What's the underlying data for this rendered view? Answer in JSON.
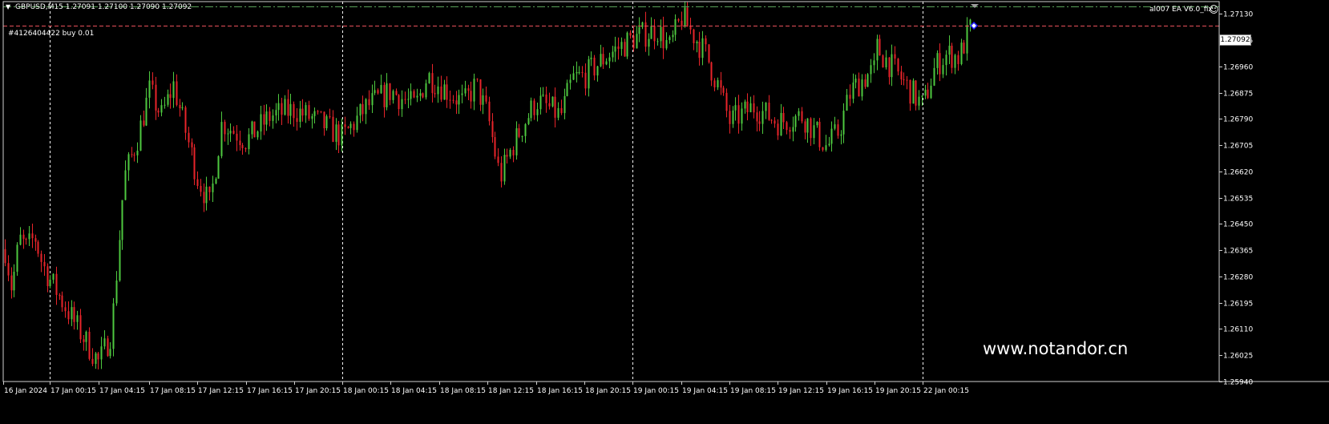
{
  "header": {
    "symbol_info": "GBPUSD,M15  1.27091 1.27100 1.27090 1.27092",
    "ea_label": "al007 EA  V6.0_fix",
    "order_label": "#4126404422 buy 0.01"
  },
  "icons": {
    "collapse": "triangle-down-icon",
    "ea_status": "smiley-icon",
    "order_marker": "diamond-icon"
  },
  "watermark": "www.notandor.cn",
  "current_price_tag": "1.27092",
  "colors": {
    "background": "#000000",
    "bull": "#4ec83f",
    "bear": "#e8242a",
    "grid": "#ffffff",
    "order_line": "#e8505a",
    "top_line": "#5aa05a"
  },
  "chart_data": {
    "type": "candlestick",
    "title": "GBPUSD,M15",
    "ylim": [
      1.2594,
      1.2717
    ],
    "price_ticks": [
      "1.27130",
      "1.27045",
      "1.26960",
      "1.26875",
      "1.26790",
      "1.26705",
      "1.26620",
      "1.26535",
      "1.26450",
      "1.26365",
      "1.26280",
      "1.26195",
      "1.26110",
      "1.26025",
      "1.25940"
    ],
    "time_ticks": [
      "16 Jan 2024",
      "17 Jan 00:15",
      "17 Jan 04:15",
      "17 Jan 08:15",
      "17 Jan 12:15",
      "17 Jan 16:15",
      "17 Jan 20:15",
      "18 Jan 00:15",
      "18 Jan 04:15",
      "18 Jan 08:15",
      "18 Jan 12:15",
      "18 Jan 16:15",
      "18 Jan 20:15",
      "19 Jan 00:15",
      "19 Jan 04:15",
      "19 Jan 08:15",
      "19 Jan 12:15",
      "19 Jan 16:15",
      "19 Jan 20:15",
      "22 Jan 00:15"
    ],
    "day_separators": [
      "17 Jan 00:15",
      "18 Jan 00:15",
      "19 Jan 00:15",
      "22 Jan 00:15"
    ],
    "order_price": 1.27092,
    "last": {
      "open": 1.27091,
      "high": 1.271,
      "low": 1.2709,
      "close": 1.27092
    },
    "close_path": [
      [
        "16 Jan 2024",
        1.264
      ],
      [
        "16 Jan 04:15",
        1.2624
      ],
      [
        "16 Jan 08:15",
        1.264
      ],
      [
        "16 Jan 12:15",
        1.2637
      ],
      [
        "16 Jan 16:15",
        1.2641
      ],
      [
        "16 Jan 20:15",
        1.2632
      ],
      [
        "17 Jan 00:15",
        1.2627
      ],
      [
        "17 Jan 02:15",
        1.2613
      ],
      [
        "17 Jan 04:15",
        1.26
      ],
      [
        "17 Jan 05:15",
        1.261
      ],
      [
        "17 Jan 06:15",
        1.266
      ],
      [
        "17 Jan 07:15",
        1.2672
      ],
      [
        "17 Jan 08:15",
        1.2688
      ],
      [
        "17 Jan 09:15",
        1.268
      ],
      [
        "17 Jan 10:15",
        1.269
      ],
      [
        "17 Jan 12:15",
        1.266
      ],
      [
        "17 Jan 13:15",
        1.2651
      ],
      [
        "17 Jan 14:15",
        1.2678
      ],
      [
        "17 Jan 16:15",
        1.2672
      ],
      [
        "17 Jan 18:15",
        1.268
      ],
      [
        "17 Jan 20:15",
        1.2682
      ],
      [
        "17 Jan 22:15",
        1.2678
      ],
      [
        "18 Jan 00:15",
        1.2673
      ],
      [
        "18 Jan 02:15",
        1.2683
      ],
      [
        "18 Jan 04:15",
        1.2688
      ],
      [
        "18 Jan 06:15",
        1.2683
      ],
      [
        "18 Jan 07:15",
        1.2693
      ],
      [
        "18 Jan 08:15",
        1.269
      ],
      [
        "18 Jan 10:15",
        1.2684
      ],
      [
        "18 Jan 11:15",
        1.269
      ],
      [
        "18 Jan 12:15",
        1.268
      ],
      [
        "18 Jan 13:15",
        1.266
      ],
      [
        "18 Jan 14:15",
        1.267
      ],
      [
        "18 Jan 15:15",
        1.2678
      ],
      [
        "18 Jan 16:15",
        1.2685
      ],
      [
        "18 Jan 18:15",
        1.268
      ],
      [
        "18 Jan 19:15",
        1.2692
      ],
      [
        "18 Jan 20:15",
        1.2693
      ],
      [
        "18 Jan 22:15",
        1.27
      ],
      [
        "19 Jan 00:15",
        1.2705
      ],
      [
        "19 Jan 02:15",
        1.2708
      ],
      [
        "19 Jan 03:15",
        1.2702
      ],
      [
        "19 Jan 04:15",
        1.2712
      ],
      [
        "19 Jan 06:15",
        1.27
      ],
      [
        "19 Jan 07:15",
        1.269
      ],
      [
        "19 Jan 08:15",
        1.2678
      ],
      [
        "19 Jan 10:15",
        1.2683
      ],
      [
        "19 Jan 12:15",
        1.2678
      ],
      [
        "19 Jan 14:15",
        1.268
      ],
      [
        "19 Jan 16:15",
        1.267
      ],
      [
        "19 Jan 17:15",
        1.2675
      ],
      [
        "19 Jan 18:15",
        1.2688
      ],
      [
        "19 Jan 19:15",
        1.2692
      ],
      [
        "19 Jan 20:15",
        1.2695
      ],
      [
        "19 Jan 22:15",
        1.2702
      ],
      [
        "22 Jan 00:15",
        1.2683
      ],
      [
        "22 Jan 01:15",
        1.2696
      ],
      [
        "22 Jan 02:15",
        1.27
      ],
      [
        "22 Jan 03:15",
        1.2699
      ],
      [
        "22 Jan 04:15",
        1.2709
      ]
    ]
  }
}
